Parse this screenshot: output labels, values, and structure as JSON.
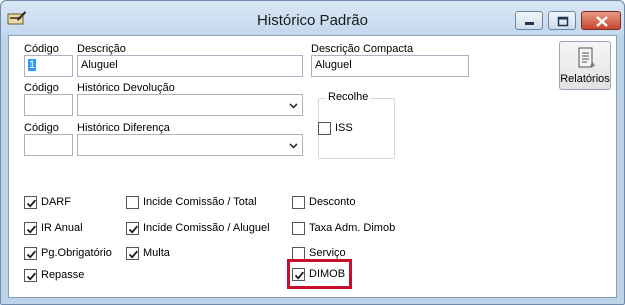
{
  "window": {
    "title": "Histórico Padrão",
    "accent": "#c8102e"
  },
  "form": {
    "row1": {
      "codigo_label": "Código",
      "codigo_value": "1",
      "descricao_label": "Descrição",
      "descricao_value": "Aluguel",
      "descricao_compacta_label": "Descrição Compacta",
      "descricao_compacta_value": "Aluguel"
    },
    "row2": {
      "codigo_label": "Código",
      "historico_label": "Histórico Devolução"
    },
    "row3": {
      "codigo_label": "Código",
      "historico_label": "Histórico Diferença"
    },
    "recolhe": {
      "title": "Recolhe",
      "iss_label": "ISS",
      "iss_checked": false
    },
    "relatorios_label": "Relatórios"
  },
  "checkboxes": {
    "darf": {
      "label": "DARF",
      "checked": true
    },
    "ir_anual": {
      "label": "IR Anual",
      "checked": true
    },
    "pg_obrigatorio": {
      "label": "Pg.Obrigatório",
      "checked": true
    },
    "repasse": {
      "label": "Repasse",
      "checked": true
    },
    "incide_total": {
      "label": "Incide Comissão / Total",
      "checked": false
    },
    "incide_aluguel": {
      "label": "Incide Comissão / Aluguel",
      "checked": true
    },
    "multa": {
      "label": "Multa",
      "checked": true
    },
    "desconto": {
      "label": "Desconto",
      "checked": false
    },
    "taxa_adm": {
      "label": "Taxa Adm. Dimob",
      "checked": false
    },
    "servico": {
      "label": "Serviço",
      "checked": false
    },
    "dimob": {
      "label": "DIMOB",
      "checked": true
    }
  }
}
